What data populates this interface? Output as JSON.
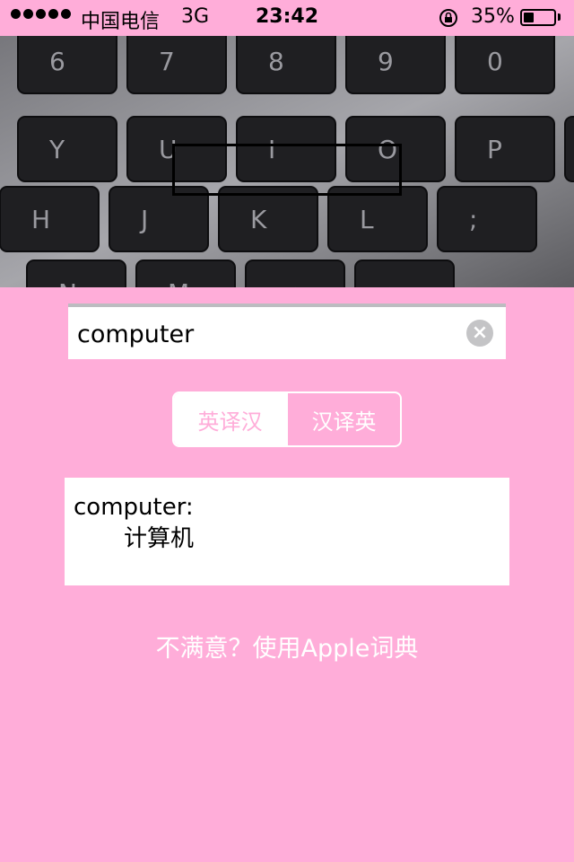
{
  "status_bar": {
    "carrier": "中国电信",
    "network": "3G",
    "time": "23:42",
    "battery_percent": "35%",
    "battery_level": 0.35,
    "orientation_lock_icon": "orientation-lock-icon",
    "signal_icon": "signal-dots-icon"
  },
  "camera": {
    "keys": [
      "6",
      "7",
      "8",
      "9",
      "0",
      "Y",
      "U",
      "I",
      "O",
      "P",
      "[",
      "H",
      "J",
      "K",
      "L",
      ";",
      "N",
      "M",
      "<",
      ">"
    ]
  },
  "search": {
    "value": "computer",
    "clear_icon": "clear-icon"
  },
  "segment": {
    "options": [
      "英译汉",
      "汉译英"
    ],
    "selected_index": 0
  },
  "result": {
    "word": "computer:",
    "meaning": "计算机"
  },
  "apple_dictionary_link": "不满意？使用Apple词典",
  "colors": {
    "background": "#ffadd9",
    "white": "#ffffff",
    "black": "#000000"
  }
}
